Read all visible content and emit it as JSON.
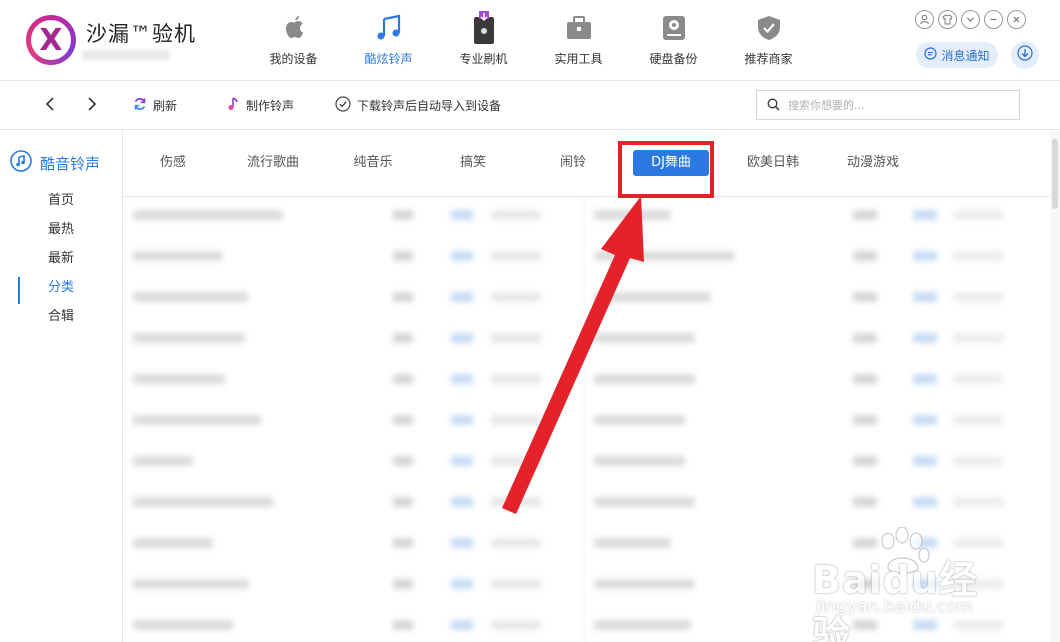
{
  "app": {
    "title": "沙漏™验机",
    "logo_letter": "X"
  },
  "topnav": [
    {
      "label": "我的设备",
      "icon": "apple-icon"
    },
    {
      "label": "酷炫铃声",
      "icon": "music-note-icon",
      "active": true
    },
    {
      "label": "专业刷机",
      "icon": "flash-phone-icon"
    },
    {
      "label": "实用工具",
      "icon": "toolbox-icon"
    },
    {
      "label": "硬盘备份",
      "icon": "hard-disk-icon"
    },
    {
      "label": "推荐商家",
      "icon": "shield-check-icon"
    }
  ],
  "header_right": {
    "notice_label": "消息通知"
  },
  "toolbar": {
    "refresh_label": "刷新",
    "make_ringtone_label": "制作铃声",
    "auto_import_label": "下载铃声后自动导入到设备",
    "search_placeholder": "搜索你想要的..."
  },
  "sidebar": {
    "title": "酷音铃声",
    "items": [
      {
        "label": "首页"
      },
      {
        "label": "最热"
      },
      {
        "label": "最新"
      },
      {
        "label": "分类",
        "active": true
      },
      {
        "label": "合辑"
      }
    ]
  },
  "categories": [
    {
      "label": "伤感"
    },
    {
      "label": "流行歌曲"
    },
    {
      "label": "纯音乐"
    },
    {
      "label": "搞笑"
    },
    {
      "label": "闹铃"
    },
    {
      "label": "DJ舞曲",
      "active": true
    },
    {
      "label": "欧美日韩"
    },
    {
      "label": "动漫游戏"
    }
  ],
  "colors": {
    "accent": "#2a7ae2",
    "annotation": "#e52229"
  },
  "watermark": {
    "brand": "Baidu经验",
    "url": "jingyan.baidu.com"
  }
}
